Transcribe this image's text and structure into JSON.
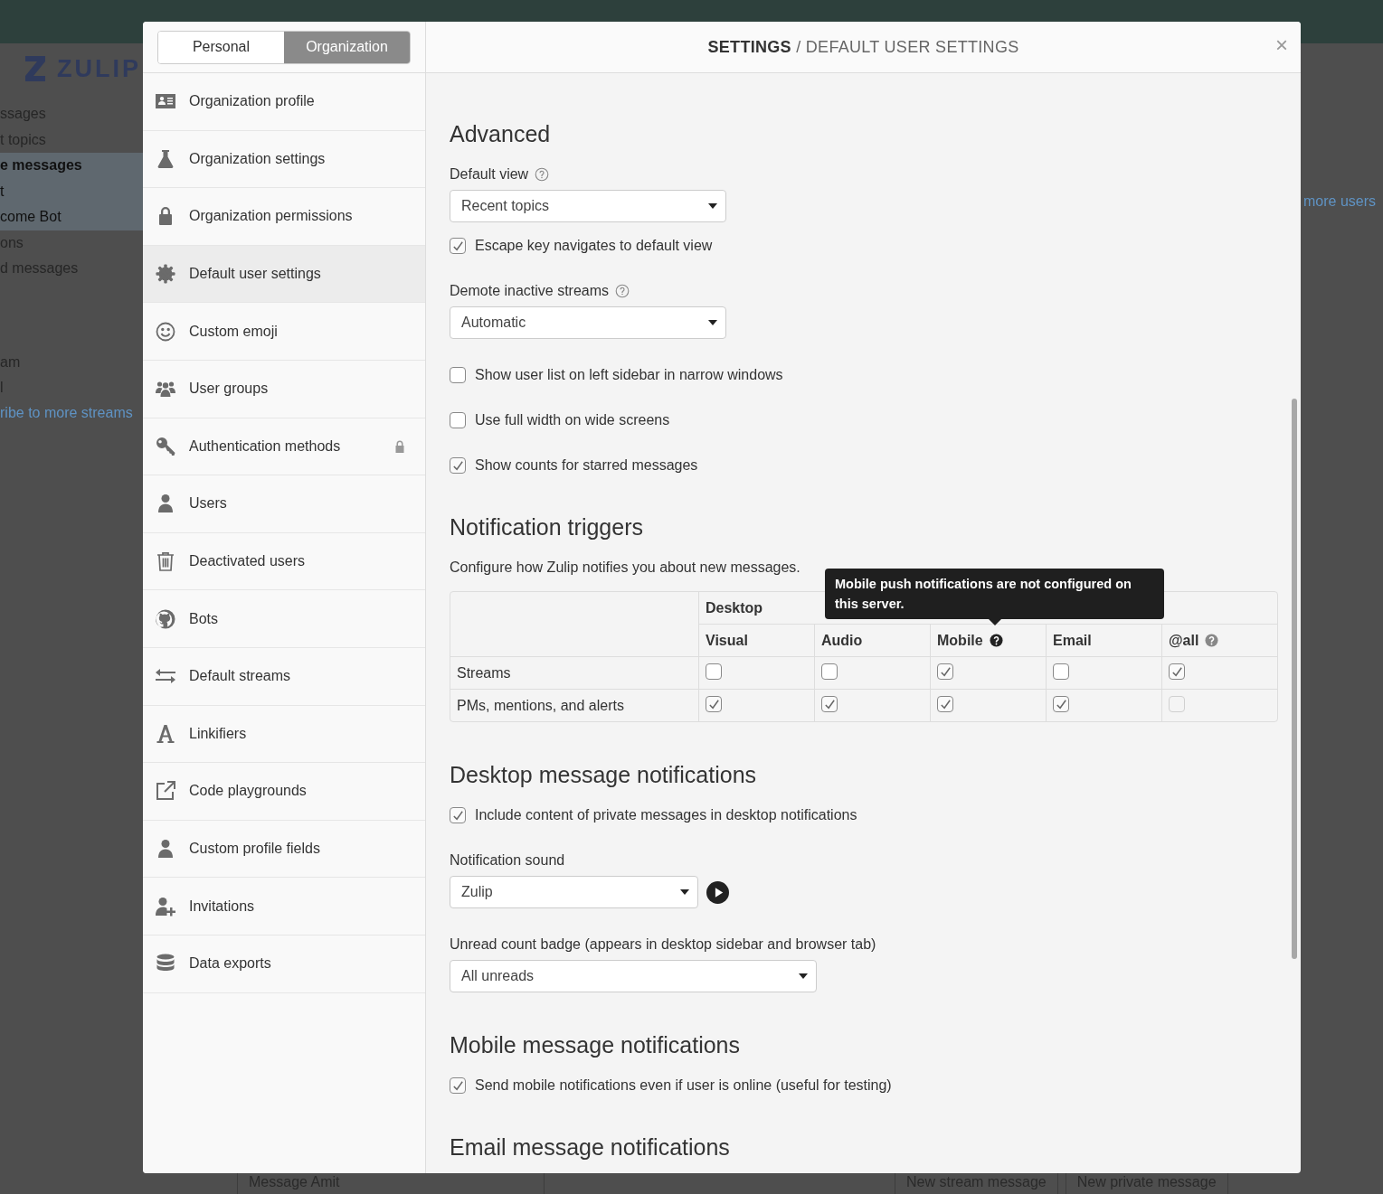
{
  "background": {
    "logo": "ZULIP",
    "left_items": [
      {
        "label": "ssages",
        "bold": false,
        "highlighted": false
      },
      {
        "label": "t topics",
        "bold": false,
        "highlighted": false
      },
      {
        "label": "e messages",
        "bold": true,
        "highlighted": true
      },
      {
        "label": "t",
        "bold": false,
        "highlighted": true
      },
      {
        "label": "come Bot",
        "bold": false,
        "highlighted": true
      },
      {
        "label": "ons",
        "bold": false,
        "highlighted": false
      },
      {
        "label": "d messages",
        "bold": false,
        "highlighted": false
      }
    ],
    "stream_items": [
      "am",
      "l"
    ],
    "streams_link": "ribe to more streams",
    "users_link": "more users",
    "compose_buttons": [
      "Message Amit",
      "New stream message",
      "New private message"
    ]
  },
  "modal": {
    "tabs": [
      {
        "label": "Personal",
        "selected": false
      },
      {
        "label": "Organization",
        "selected": true
      }
    ],
    "title": "**SETTINGS** / DEFAULT USER SETTINGS",
    "close": "×",
    "nav": [
      {
        "label": "Organization profile",
        "kind": "id-card",
        "selected": false,
        "locked": false
      },
      {
        "label": "Organization settings",
        "kind": "flask",
        "selected": false,
        "locked": false
      },
      {
        "label": "Organization permissions",
        "kind": "lock",
        "selected": false,
        "locked": false
      },
      {
        "label": "Default user settings",
        "kind": "gear",
        "selected": true,
        "locked": false
      },
      {
        "label": "Custom emoji",
        "kind": "smiley",
        "selected": false,
        "locked": false
      },
      {
        "label": "User groups",
        "kind": "users",
        "selected": false,
        "locked": false
      },
      {
        "label": "Authentication methods",
        "kind": "key",
        "selected": false,
        "locked": true
      },
      {
        "label": "Users",
        "kind": "user",
        "selected": false,
        "locked": false
      },
      {
        "label": "Deactivated users",
        "kind": "trash",
        "selected": false,
        "locked": false
      },
      {
        "label": "Bots",
        "kind": "cat",
        "selected": false,
        "locked": false
      },
      {
        "label": "Default streams",
        "kind": "arrows",
        "selected": false,
        "locked": false
      },
      {
        "label": "Linkifiers",
        "kind": "letter",
        "selected": false,
        "locked": false
      },
      {
        "label": "Code playgrounds",
        "kind": "external",
        "selected": false,
        "locked": false
      },
      {
        "label": "Custom profile fields",
        "kind": "user",
        "selected": false,
        "locked": false
      },
      {
        "label": "Invitations",
        "kind": "user-plus",
        "selected": false,
        "locked": false
      },
      {
        "label": "Data exports",
        "kind": "database",
        "selected": false,
        "locked": false
      }
    ],
    "settings": [
      {
        "kind": "heading",
        "text": "Advanced"
      },
      {
        "kind": "select",
        "label": "Default view",
        "help": true,
        "value": "Recent topics",
        "checkbox": {
          "label": "Escape key navigates to default view",
          "checked": true
        }
      },
      {
        "kind": "select",
        "label": "Demote inactive streams",
        "help": true,
        "value": "Automatic"
      },
      {
        "kind": "checkbox",
        "label": "Show user list on left sidebar in narrow windows",
        "checked": false
      },
      {
        "kind": "checkbox",
        "label": "Use full width on wide screens",
        "checked": false
      },
      {
        "kind": "checkbox",
        "label": "Show counts for starred messages",
        "checked": true
      },
      {
        "kind": "heading",
        "text": "Notification triggers"
      },
      {
        "kind": "text",
        "text": "Configure how Zulip notifies you about new messages."
      },
      {
        "kind": "table",
        "group": "Desktop",
        "tooltip": "Mobile push notifications are not configured on this server.",
        "columns": [
          {
            "label": "Visual",
            "help": false
          },
          {
            "label": "Audio",
            "help": false
          },
          {
            "label": "Mobile",
            "help": true
          },
          {
            "label": "Email",
            "help": false
          },
          {
            "label": "@all",
            "help": true
          }
        ],
        "rows": [
          {
            "label": "Streams",
            "cells": [
              {
                "checked": false,
                "disabled": false
              },
              {
                "checked": false,
                "disabled": false
              },
              {
                "checked": true,
                "disabled": false
              },
              {
                "checked": false,
                "disabled": false
              },
              {
                "checked": true,
                "disabled": false
              }
            ]
          },
          {
            "label": "PMs, mentions, and alerts",
            "cells": [
              {
                "checked": true,
                "disabled": false
              },
              {
                "checked": true,
                "disabled": false
              },
              {
                "checked": true,
                "disabled": false
              },
              {
                "checked": true,
                "disabled": false
              },
              {
                "checked": false,
                "disabled": true
              }
            ]
          }
        ]
      },
      {
        "kind": "heading",
        "text": "Desktop message notifications"
      },
      {
        "kind": "checkbox",
        "label": "Include content of private messages in desktop notifications",
        "checked": true
      },
      {
        "kind": "select",
        "label": "Notification sound",
        "help": false,
        "value": "Zulip",
        "play": true
      },
      {
        "kind": "select",
        "label": "Unread count badge (appears in desktop sidebar and browser tab)",
        "help": false,
        "value": "All unreads"
      },
      {
        "kind": "heading",
        "text": "Mobile message notifications"
      },
      {
        "kind": "checkbox",
        "label": "Send mobile notifications even if user is online (useful for testing)",
        "checked": true
      },
      {
        "kind": "heading",
        "text": "Email message notifications"
      }
    ]
  }
}
